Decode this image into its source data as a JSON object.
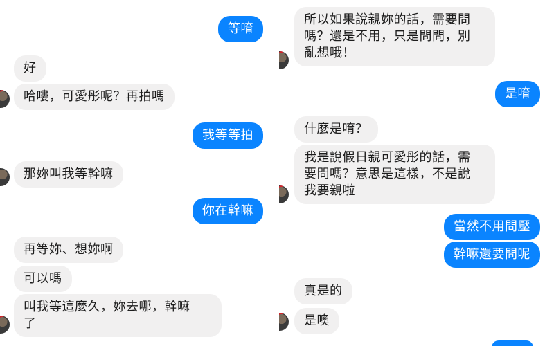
{
  "left_conversation": {
    "messages": [
      {
        "side": "out",
        "text": "等唷"
      },
      {
        "side": "in",
        "text": "好"
      },
      {
        "side": "in",
        "text": "哈嘍，可愛彤呢？再拍嗎"
      },
      {
        "side": "out",
        "text": "我等等拍"
      },
      {
        "side": "in",
        "text": "那妳叫我等幹嘛"
      },
      {
        "side": "out",
        "text": "你在幹嘛"
      },
      {
        "side": "in",
        "text": "再等妳、想妳啊"
      },
      {
        "side": "in",
        "text": "可以嗎"
      },
      {
        "side": "in",
        "text": "叫我等這麼久，妳去哪，幹嘛\n了"
      }
    ]
  },
  "right_conversation": {
    "messages": [
      {
        "side": "in",
        "text": "所以如果說親妳的話，需要問\n嗎？還是不用，只是問問，別\n亂想哦！"
      },
      {
        "side": "out",
        "text": "是唷"
      },
      {
        "side": "in",
        "text": "什麼是唷？"
      },
      {
        "side": "in",
        "text": "我是說假日親可愛彤的話，需\n要問嗎？意思是這樣，不是說\n我要親啦"
      },
      {
        "side": "out",
        "text": "當然不用問壓"
      },
      {
        "side": "out",
        "text": "幹嘛還要問呢"
      },
      {
        "side": "in",
        "text": "真是的"
      },
      {
        "side": "in",
        "text": "是噢"
      }
    ]
  },
  "colors": {
    "outgoing_bubble": "#0a84ff",
    "incoming_bubble": "#f1f0f0",
    "outgoing_text": "#ffffff",
    "incoming_text": "#1d1d1d",
    "background": "#ffffff"
  },
  "icons": {
    "contact_avatar": "avatar-icon"
  }
}
